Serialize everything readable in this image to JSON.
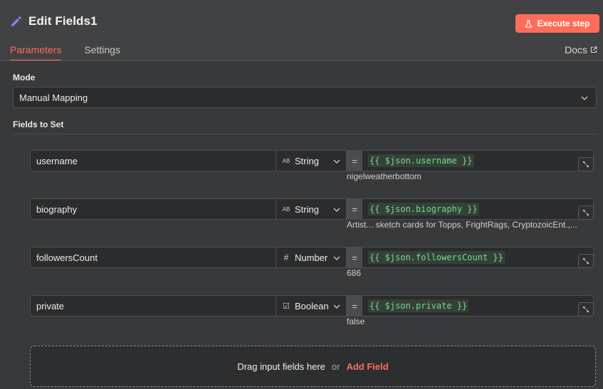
{
  "header": {
    "title": "Edit Fields1",
    "execute_label": "Execute step",
    "tabs": [
      {
        "label": "Parameters",
        "active": true
      },
      {
        "label": "Settings",
        "active": false
      }
    ],
    "docs_label": "Docs"
  },
  "mode": {
    "label": "Mode",
    "value": "Manual Mapping"
  },
  "fields_section": {
    "label": "Fields to Set"
  },
  "fields": [
    {
      "name": "username",
      "type_icon": "AB",
      "type": "String",
      "expression": "{{ $json.username }}",
      "preview": "nigelweatherbottom"
    },
    {
      "name": "biography",
      "type_icon": "AB",
      "type": "String",
      "expression": "{{ $json.biography }}",
      "preview": "Artist... sketch cards for Topps, FrightRags, CryptozoicEnt.,..."
    },
    {
      "name": "followersCount",
      "type_icon": "#",
      "type": "Number",
      "expression": "{{ $json.followersCount }}",
      "preview": "686"
    },
    {
      "name": "private",
      "type_icon": "☑",
      "type": "Boolean",
      "expression": "{{ $json.private }}",
      "preview": "false"
    }
  ],
  "dropzone": {
    "text": "Drag input fields here",
    "or": "or",
    "add_label": "Add Field"
  },
  "colors": {
    "accent": "#ff6d5a",
    "expression_green": "#7bd88f",
    "panel_bg": "#38393b",
    "input_bg": "#2b2c2e"
  }
}
